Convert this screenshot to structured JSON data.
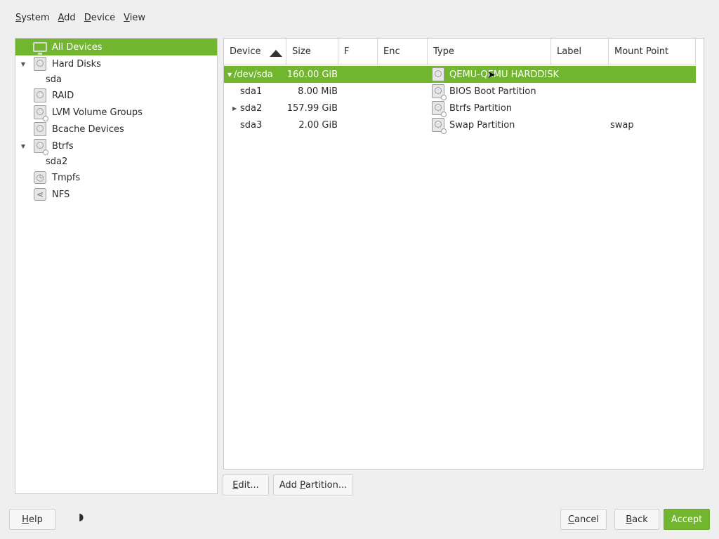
{
  "menubar": {
    "items": [
      {
        "mnemonic": "S",
        "rest": "ystem"
      },
      {
        "mnemonic": "A",
        "rest": "dd"
      },
      {
        "mnemonic": "D",
        "rest": "evice"
      },
      {
        "mnemonic": "V",
        "rest": "iew"
      }
    ]
  },
  "tree": {
    "items": [
      {
        "label": "All Devices",
        "icon": "monitor-icon",
        "selected": true
      },
      {
        "label": "Hard Disks",
        "icon": "hard-disk-icon",
        "expanded": true
      },
      {
        "label": "sda"
      },
      {
        "label": "RAID",
        "icon": "raid-icon"
      },
      {
        "label": "LVM Volume Groups",
        "icon": "lvm-icon"
      },
      {
        "label": "Bcache Devices",
        "icon": "bcache-icon"
      },
      {
        "label": "Btrfs",
        "icon": "btrfs-icon",
        "expanded": true
      },
      {
        "label": "sda2"
      },
      {
        "label": "Tmpfs",
        "icon": "tmpfs-icon"
      },
      {
        "label": "NFS",
        "icon": "nfs-icon"
      }
    ]
  },
  "table": {
    "headers": [
      "Device",
      "Size",
      "F",
      "Enc",
      "Type",
      "Label",
      "Mount Point"
    ],
    "sort": {
      "column": "Device",
      "direction": "ascending"
    },
    "rows": [
      {
        "device": "/dev/sda",
        "size": "160.00 GiB",
        "type": "QEMU-QEMU HARDDISK",
        "label": "",
        "mount": "",
        "selected": true,
        "expander": "expanded"
      },
      {
        "device": "sda1",
        "size": "8.00 MiB",
        "type": "BIOS Boot Partition",
        "label": "",
        "mount": ""
      },
      {
        "device": "sda2",
        "size": "157.99 GiB",
        "type": "Btrfs Partition",
        "label": "",
        "mount": "",
        "expander": "collapsed"
      },
      {
        "device": "sda3",
        "size": "2.00 GiB",
        "type": "Swap Partition",
        "label": "",
        "mount": "swap"
      }
    ]
  },
  "actions": {
    "edit": {
      "mnemonic": "E",
      "rest": "dit..."
    },
    "add_partition": {
      "pre": "Add ",
      "mnemonic": "P",
      "rest": "artition..."
    }
  },
  "footer": {
    "help": {
      "mnemonic": "H",
      "rest": "elp"
    },
    "cancel": {
      "mnemonic": "C",
      "rest": "ancel"
    },
    "back": {
      "mnemonic": "B",
      "rest": "ack"
    },
    "accept": {
      "mnemonic": "A",
      "rest": "ccept"
    }
  },
  "colors": {
    "accent": "#72b62f"
  }
}
